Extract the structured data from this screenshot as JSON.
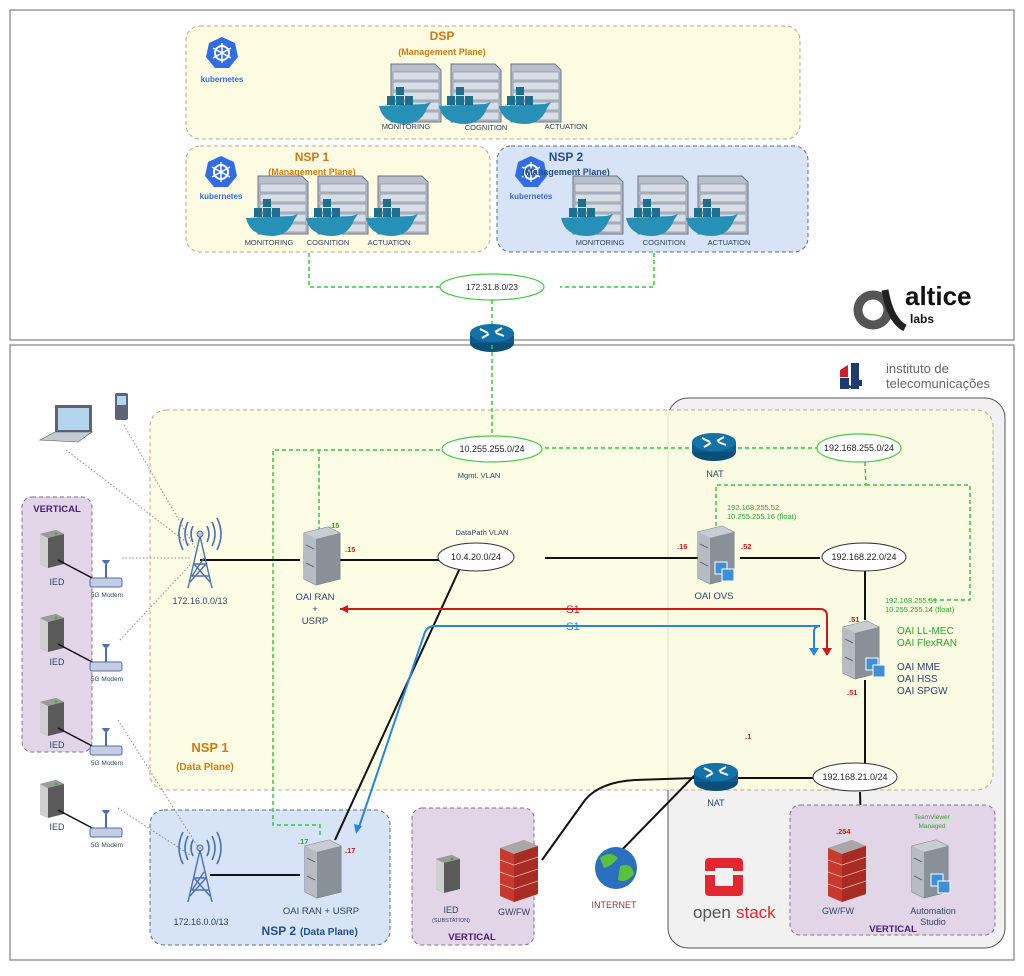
{
  "top_section": {
    "company": {
      "name": "altice",
      "sub": "labs"
    },
    "dsp": {
      "title": "DSP",
      "subtitle": "(Management Plane)",
      "k8s_label": "kubernetes",
      "services": [
        "MONITORING",
        "COGNITION",
        "ACTUATION"
      ]
    },
    "nsp1": {
      "title": "NSP 1",
      "subtitle": "(Management Plane)",
      "k8s_label": "kubernetes",
      "services": [
        "MONITORING",
        "COGNITION",
        "ACTUATION"
      ]
    },
    "nsp2": {
      "title": "NSP 2",
      "subtitle": "(Management Plane)",
      "k8s_label": "kubernetes",
      "services": [
        "MONITORING",
        "COGNITION",
        "ACTUATION"
      ]
    },
    "mgmt_cloud": "172.31.8.0/23"
  },
  "bottom_section": {
    "institute": {
      "line1": "instituto de",
      "line2": "telecomunicações"
    },
    "nsp1_data": {
      "title": "NSP 1",
      "subtitle": "(Data Plane)"
    },
    "nsp2_data": {
      "title": "NSP 2",
      "subtitle": "(Data Plane)"
    },
    "mgmt_vlan": {
      "cloud": "10.255.255.0/24",
      "label": "Mgmt. VLAN"
    },
    "datapath_vlan": {
      "cloud": "10.4.20.0/24",
      "label": "DataPath VLAN"
    },
    "cloud_192_255": "192.168.255.0/24",
    "cloud_192_22": "192.168.22.0/24",
    "cloud_192_21": "192.168.21.0/24",
    "tower1_subnet": "172.16.0.0/13",
    "tower2_subnet": "172.16.0.0/13",
    "oai_ran1": {
      "line1": "OAI RAN",
      "line2": "+",
      "line3": "USRP",
      "ip_mgmt": ".15",
      "ip_data": ".15"
    },
    "oai_ran2": {
      "label": "OAI RAN + USRP",
      "ip_mgmt": ".17",
      "ip_data": ".17"
    },
    "oai_ovs": {
      "label": "OAI OVS",
      "ip_left": ".16",
      "ip_right": ".52",
      "mgmt_ip1": "192.168.255.52",
      "mgmt_ip2": "10.255.255.16 (float)"
    },
    "oai_core": {
      "ip_top": ".51",
      "ip_bottom": ".51",
      "mgmt_ip1": "192.168.255.51",
      "mgmt_ip2": "10.255.255.14 (float)",
      "green_services": [
        "OAI LL-MEC",
        "OAI FlexRAN"
      ],
      "services": [
        "OAI MME",
        "OAI HSS",
        "OAI SPGW"
      ]
    },
    "nat_top": "NAT",
    "nat_bottom": {
      "label": "NAT",
      "ip": ".1"
    },
    "s1_red": "S1",
    "s1_blue": "S1",
    "vertical_left": {
      "title": "VERTICAL",
      "devices": [
        {
          "ied": "IED",
          "modem": "5G Modem"
        },
        {
          "ied": "IED",
          "modem": "5G Modem"
        },
        {
          "ied": "IED",
          "modem": "5G Modem"
        },
        {
          "ied": "IED",
          "modem": "5G Modem"
        }
      ]
    },
    "vertical_substation": {
      "title": "VERTICAL",
      "ied": "IED",
      "ied_sub": "(SUBSTATION)",
      "fw": "GW/FW"
    },
    "internet": "INTERNET",
    "openstack": {
      "part1": "open",
      "part2": "stack"
    },
    "vertical_right": {
      "title": "VERTICAL",
      "fw": "GW/FW",
      "fw_ip": ".254",
      "teamviewer1": "TeamViewer",
      "teamviewer2": "Managed",
      "studio1": "Automation",
      "studio2": "Studio"
    }
  }
}
